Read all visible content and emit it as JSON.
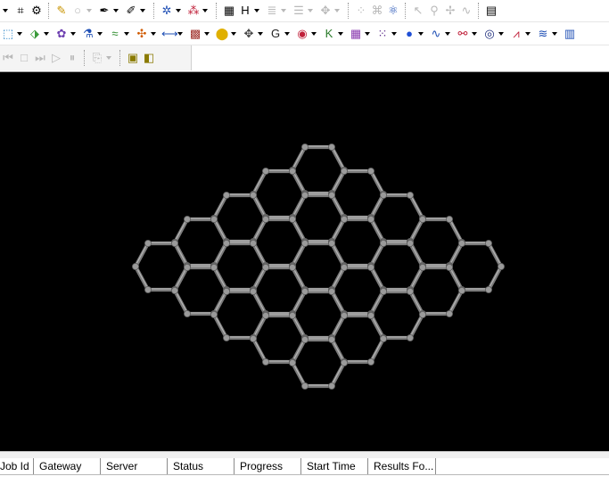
{
  "toolbar_row1": [
    {
      "icon": "dropdown-arrow-icon",
      "glyph": "",
      "arrow": true
    },
    {
      "icon": "fit-to-window-icon",
      "glyph": "⌗"
    },
    {
      "icon": "properties-icon",
      "glyph": "⚙"
    },
    {
      "sep": true
    },
    {
      "icon": "pencil-icon",
      "glyph": "✎",
      "color": "#c89400"
    },
    {
      "icon": "circle-icon",
      "glyph": "○",
      "dis": true,
      "arrow": true
    },
    {
      "icon": "sketch-pen-icon",
      "glyph": "✒",
      "arrow": true
    },
    {
      "icon": "sketch-tool-icon",
      "glyph": "✐",
      "arrow": true
    },
    {
      "sep": true
    },
    {
      "icon": "clean-structure-icon",
      "glyph": "✲",
      "color": "#1f4fb5",
      "arrow": true
    },
    {
      "icon": "atom-selection-icon",
      "glyph": "⁂",
      "color": "#c0203a",
      "arrow": true
    },
    {
      "sep": true
    },
    {
      "icon": "matrix-icon",
      "glyph": "▦",
      "arrow": false
    },
    {
      "icon": "hydrogen-icon",
      "glyph": "H",
      "arrow": true
    },
    {
      "icon": "layer-icon",
      "glyph": "≣",
      "dis": true,
      "arrow": true
    },
    {
      "icon": "align-icon",
      "glyph": "☰",
      "dis": true,
      "arrow": true
    },
    {
      "icon": "move-icon",
      "glyph": "✥",
      "dis": true,
      "arrow": true
    },
    {
      "sep": true
    },
    {
      "icon": "symmetry-icon",
      "glyph": "⁘",
      "dis": true
    },
    {
      "icon": "abc-icon",
      "glyph": "⌘",
      "dis": true
    },
    {
      "icon": "molecule-icon",
      "glyph": "⚛",
      "color": "#1f4fb5"
    },
    {
      "sep": true
    },
    {
      "icon": "pointer-icon",
      "glyph": "↖",
      "dis": true
    },
    {
      "icon": "zoom-icon",
      "glyph": "⚲",
      "dis": true
    },
    {
      "icon": "translate-icon",
      "glyph": "✢",
      "dis": true
    },
    {
      "icon": "spectrum-icon",
      "glyph": "∿",
      "dis": true
    },
    {
      "sep": true
    },
    {
      "icon": "panel-icon",
      "glyph": "▤"
    }
  ],
  "toolbar_row2": [
    {
      "icon": "build-crystal-icon",
      "glyph": "⬚",
      "color": "#1b7cc4",
      "arrow": true
    },
    {
      "icon": "surface-icon",
      "glyph": "⬗",
      "color": "#3a9a3a",
      "arrow": true
    },
    {
      "icon": "cluster-icon",
      "glyph": "✿",
      "color": "#6d3fb0",
      "arrow": true
    },
    {
      "icon": "flask-icon",
      "glyph": "⚗",
      "color": "#1f4fb5",
      "arrow": true
    },
    {
      "icon": "wave-icon",
      "glyph": "≈",
      "color": "#2a8a2a",
      "arrow": true
    },
    {
      "icon": "nanostructure-icon",
      "glyph": "✣",
      "color": "#d05a00",
      "arrow": true
    },
    {
      "icon": "bracket-icon",
      "glyph": "⟷",
      "color": "#1f4fb5",
      "arrow": true
    },
    {
      "icon": "grid-icon",
      "glyph": "▩",
      "color": "#a0302a",
      "arrow": true
    },
    {
      "icon": "spheres-icon",
      "glyph": "⬤",
      "color": "#e0b000",
      "arrow": true
    },
    {
      "icon": "diamond-lattice-icon",
      "glyph": "✥",
      "color": "#444444",
      "arrow": true
    },
    {
      "icon": "g-icon",
      "glyph": "G",
      "color": "#222222",
      "arrow": true
    },
    {
      "icon": "target-icon",
      "glyph": "◉",
      "color": "#c0203a",
      "arrow": true
    },
    {
      "icon": "k-icon",
      "glyph": "K",
      "color": "#2a7a2a",
      "arrow": true
    },
    {
      "icon": "texture-icon",
      "glyph": "▦",
      "color": "#8a3ab0",
      "arrow": true
    },
    {
      "icon": "dots-icon",
      "glyph": "⁙",
      "color": "#5a2a8a",
      "arrow": true
    },
    {
      "icon": "sphere-icon",
      "glyph": "●",
      "color": "#1f4fd5",
      "arrow": true
    },
    {
      "icon": "curve-icon",
      "glyph": "∿",
      "color": "#1f4fb5",
      "arrow": true
    },
    {
      "icon": "dna-icon",
      "glyph": "⚯",
      "color": "#c0203a",
      "arrow": true
    },
    {
      "icon": "orbit-icon",
      "glyph": "◎",
      "color": "#1a2a7a",
      "arrow": true
    },
    {
      "icon": "graph-icon",
      "glyph": "⩘",
      "color": "#c0203a",
      "arrow": true
    },
    {
      "icon": "stream-icon",
      "glyph": "≋",
      "color": "#1f4fb5",
      "arrow": true
    },
    {
      "icon": "table-icon",
      "glyph": "▥",
      "color": "#1f4fb5"
    }
  ],
  "toolbar_row3": [
    {
      "icon": "rewind-icon",
      "glyph": "⏮",
      "dis": true
    },
    {
      "icon": "stop-icon",
      "glyph": "□",
      "dis": true
    },
    {
      "icon": "step-forward-icon",
      "glyph": "⏭",
      "dis": true
    },
    {
      "icon": "play-icon",
      "glyph": "▷",
      "dis": true
    },
    {
      "icon": "pause-icon",
      "glyph": "⏸",
      "dis": true
    },
    {
      "sep": true
    },
    {
      "icon": "export-icon",
      "glyph": "⎘",
      "dis": true,
      "arrow": true
    },
    {
      "sep": true
    },
    {
      "icon": "cube-yellow-icon",
      "glyph": "▣",
      "color": "#8a7a00"
    },
    {
      "icon": "box-yellow-icon",
      "glyph": "◧",
      "color": "#8a7a00"
    }
  ],
  "structure": {
    "atom_color": "#9a9a9a",
    "bond_color": "#7c7c7c",
    "background": "#000000",
    "rings": "hexagonal graphene sheet"
  },
  "jobs_table": {
    "columns": [
      "Job Id",
      "Gateway",
      "Server",
      "Status",
      "Progress",
      "Start Time",
      "Results Fo..."
    ]
  }
}
